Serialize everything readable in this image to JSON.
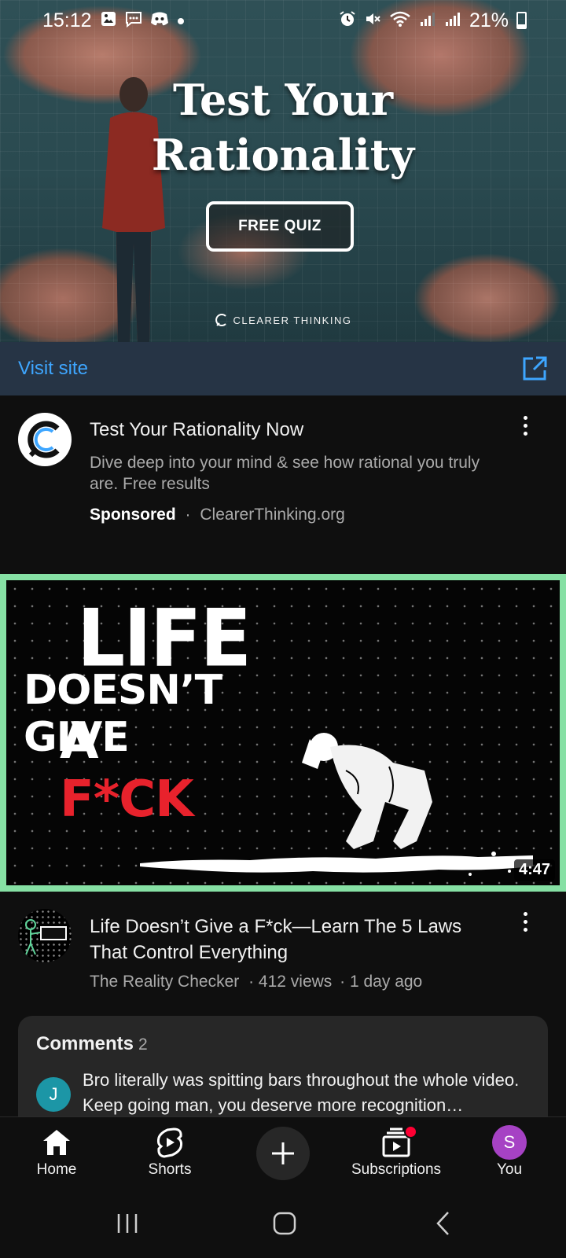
{
  "status_bar": {
    "time": "15:12",
    "battery": "21%",
    "left_icons": [
      "image-icon",
      "message-icon",
      "discord-icon",
      "dot-icon"
    ],
    "right_icons": [
      "alarm-icon",
      "mute-icon",
      "wifi-icon",
      "signal-icon",
      "signal-icon",
      "battery-icon"
    ]
  },
  "ad": {
    "banner": {
      "title_line1": "Test Your",
      "title_line2": "Rationality",
      "cta": "FREE QUIZ",
      "brand": "CLEARER THINKING"
    },
    "visit_site": "Visit site",
    "title": "Test Your Rationality Now",
    "description": "Dive deep into your mind & see how rational you truly are. Free results",
    "sponsored": "Sponsored",
    "separator": "·",
    "domain": "ClearerThinking.org"
  },
  "video": {
    "thumbnail": {
      "line1": "LIFE",
      "line2": "DOESN’T GIVE",
      "line3_a": "A ",
      "line3_b": "F*CK"
    },
    "duration": "4:47",
    "title": "Life Doesn’t Give a F*ck—Learn The 5 Laws That Control Everything",
    "channel": "The Reality Checker",
    "channel_avatar_text": "THE REALITY CHECKER",
    "views": "· 412 views",
    "age": "· 1 day ago",
    "highlight_color": "#86e0a4"
  },
  "comments": {
    "title": "Comments",
    "count": "2",
    "avatar_letter": "J",
    "text": "Bro literally was spitting bars throughout the whole video. Keep going man, you deserve more recognition…"
  },
  "bottom_nav": {
    "home": "Home",
    "shorts": "Shorts",
    "subscriptions": "Subscriptions",
    "you": "You",
    "you_avatar": "S"
  },
  "colors": {
    "accent_blue": "#3ea6ff",
    "visit_bar_bg": "#263445",
    "you_avatar_bg": "#a642c4",
    "comment_avatar_bg": "#1c96a6",
    "thumbnail_red": "#e8222c"
  }
}
